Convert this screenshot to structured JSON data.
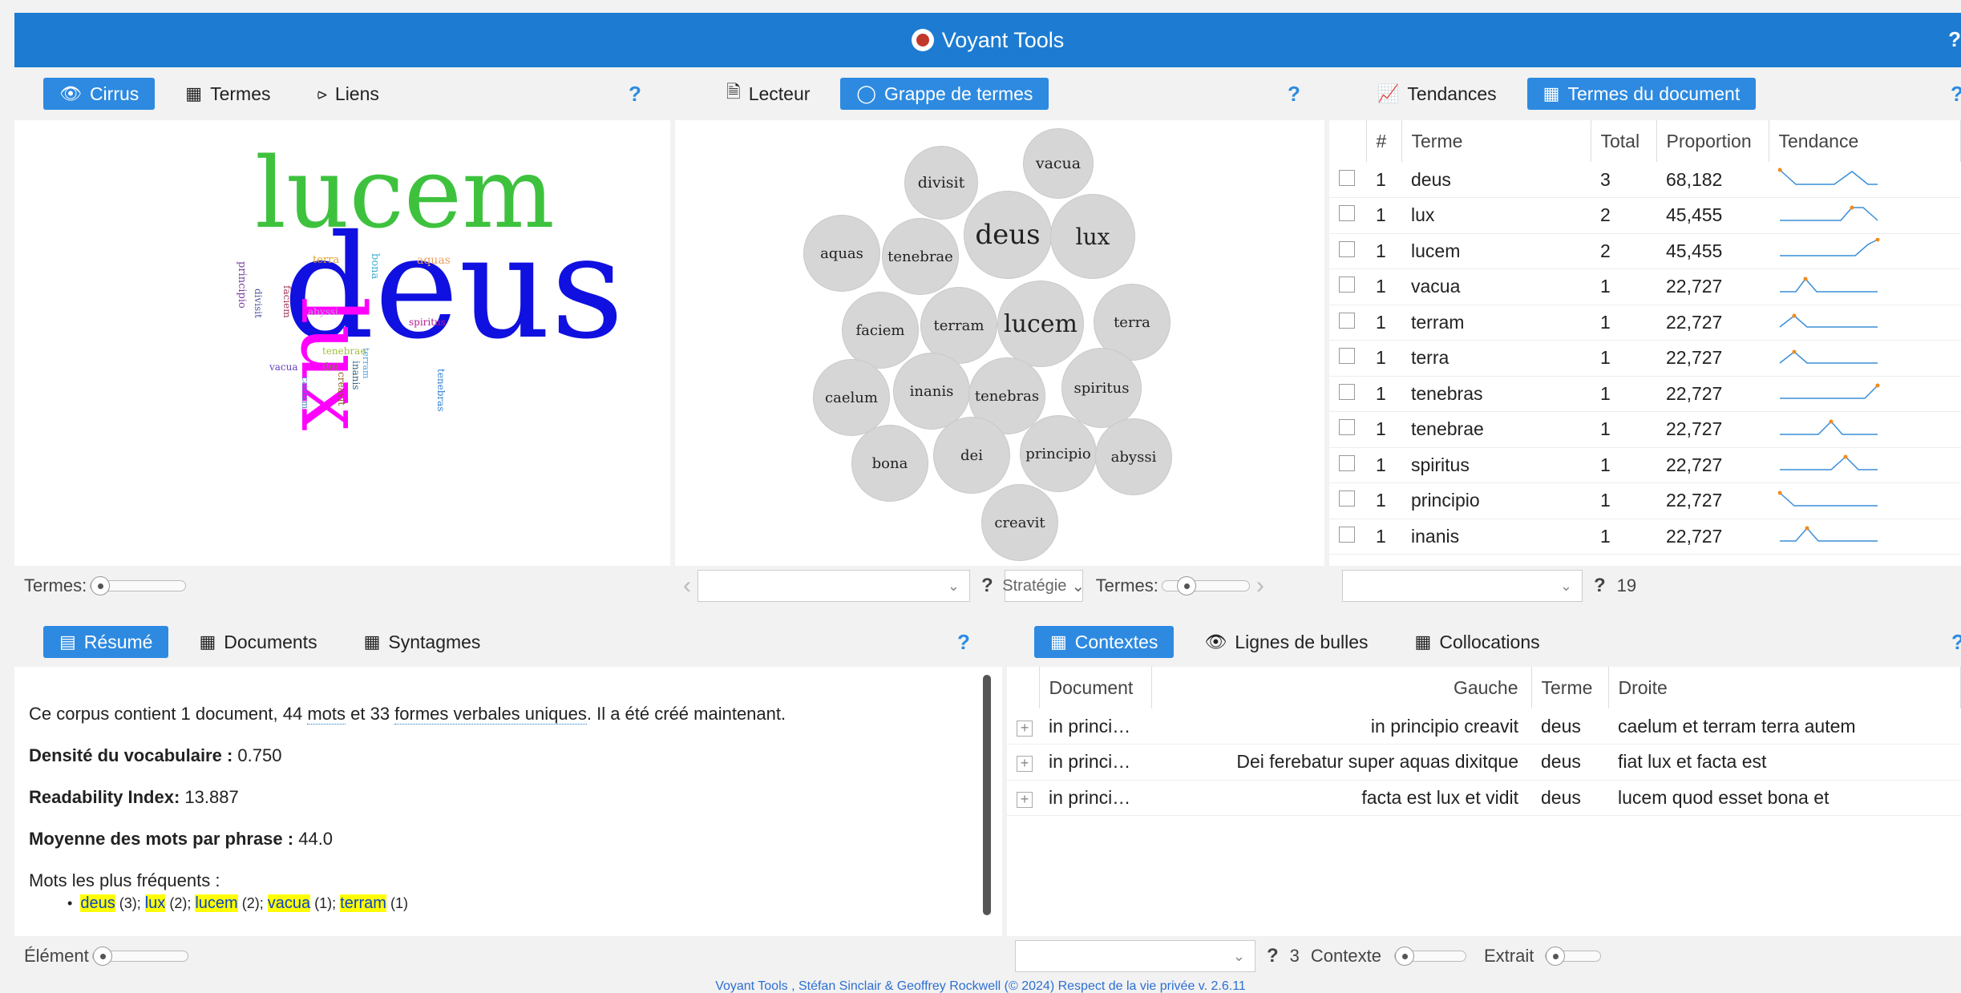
{
  "header": {
    "title": "Voyant Tools",
    "help": "?"
  },
  "cirrus_panel": {
    "tabs": [
      {
        "label": "Cirrus",
        "icon": "eye-icon"
      },
      {
        "label": "Termes",
        "icon": "table-icon"
      },
      {
        "label": "Liens",
        "icon": "share-icon"
      }
    ],
    "help": "?",
    "terms_label": "Termes:",
    "words": [
      {
        "text": "lucem",
        "color": "#3ec23e"
      },
      {
        "text": "deus",
        "color": "#1010e0"
      },
      {
        "text": "lux",
        "color": "#ff00ff"
      },
      {
        "text": "aquas",
        "color": "#e8a060"
      },
      {
        "text": "terra",
        "color": "#e0a030"
      },
      {
        "text": "bona",
        "color": "#40b0d0"
      },
      {
        "text": "principio",
        "color": "#7a40a0"
      },
      {
        "text": "faciem",
        "color": "#a03050"
      },
      {
        "text": "divisit",
        "color": "#5050a0"
      },
      {
        "text": "abyssi",
        "color": "#c0a0d0"
      },
      {
        "text": "spiritus",
        "color": "#b02090"
      },
      {
        "text": "tenebrae",
        "color": "#a0c040"
      },
      {
        "text": "terram",
        "color": "#50a0e0"
      },
      {
        "text": "vacua",
        "color": "#6040c0"
      },
      {
        "text": "dei",
        "color": "#808040"
      },
      {
        "text": "inanis",
        "color": "#306080"
      },
      {
        "text": "caelum",
        "color": "#5080c0"
      },
      {
        "text": "creavit",
        "color": "#8a5a20"
      },
      {
        "text": "tenebras",
        "color": "#3080d0"
      }
    ]
  },
  "grappe_panel": {
    "tabs": [
      {
        "label": "Lecteur",
        "icon": "document-icon"
      },
      {
        "label": "Grappe de termes",
        "icon": "circle-icon"
      }
    ],
    "help": "?",
    "bubbles": [
      "vacua",
      "divisit",
      "deus",
      "lux",
      "aquas",
      "tenebrae",
      "faciem",
      "terram",
      "lucem",
      "terra",
      "caelum",
      "inanis",
      "tenebras",
      "spiritus",
      "bona",
      "dei",
      "principio",
      "abyssi",
      "creavit"
    ],
    "strategy_label": "Stratégie",
    "terms_label": "Termes:"
  },
  "termes_panel": {
    "tabs": [
      {
        "label": "Tendances",
        "icon": "line-chart-icon"
      },
      {
        "label": "Termes du document",
        "icon": "table-icon"
      }
    ],
    "help": "?",
    "columns": [
      "#",
      "Terme",
      "Total",
      "Proportion",
      "Tendance"
    ],
    "rows": [
      {
        "num": "1",
        "term": "deus",
        "total": "3",
        "proportion": "68,182"
      },
      {
        "num": "1",
        "term": "lux",
        "total": "2",
        "proportion": "45,455"
      },
      {
        "num": "1",
        "term": "lucem",
        "total": "2",
        "proportion": "45,455"
      },
      {
        "num": "1",
        "term": "vacua",
        "total": "1",
        "proportion": "22,727"
      },
      {
        "num": "1",
        "term": "terram",
        "total": "1",
        "proportion": "22,727"
      },
      {
        "num": "1",
        "term": "terra",
        "total": "1",
        "proportion": "22,727"
      },
      {
        "num": "1",
        "term": "tenebras",
        "total": "1",
        "proportion": "22,727"
      },
      {
        "num": "1",
        "term": "tenebrae",
        "total": "1",
        "proportion": "22,727"
      },
      {
        "num": "1",
        "term": "spiritus",
        "total": "1",
        "proportion": "22,727"
      },
      {
        "num": "1",
        "term": "principio",
        "total": "1",
        "proportion": "22,727"
      },
      {
        "num": "1",
        "term": "inanis",
        "total": "1",
        "proportion": "22,727"
      }
    ],
    "count": "19"
  },
  "resume_panel": {
    "tabs": [
      {
        "label": "Résumé",
        "icon": "summary-icon"
      },
      {
        "label": "Documents",
        "icon": "table-icon"
      },
      {
        "label": "Syntagmes",
        "icon": "table-icon"
      }
    ],
    "help": "?",
    "intro_1": "Ce corpus contient 1 document, 44 ",
    "intro_mots": "mots",
    "intro_2": " et 33 ",
    "intro_formes": "formes verbales uniques",
    "intro_3": ". Il a été créé maintenant.",
    "density_label": "Densité du vocabulaire :",
    "density_value": "0.750",
    "readability_label": "Readability Index:",
    "readability_value": "13.887",
    "avg_label": "Moyenne des mots par phrase :",
    "avg_value": "44.0",
    "freq_label": "Mots les plus fréquents :",
    "freq": [
      {
        "term": "deus",
        "count": "(3)"
      },
      {
        "term": "lux",
        "count": "(2)"
      },
      {
        "term": "lucem",
        "count": "(2)"
      },
      {
        "term": "vacua",
        "count": "(1)"
      },
      {
        "term": "terram",
        "count": "(1)"
      }
    ],
    "element_label": "Élément"
  },
  "contexts_panel": {
    "tabs": [
      {
        "label": "Contextes",
        "icon": "table-icon"
      },
      {
        "label": "Lignes de bulles",
        "icon": "eye-icon"
      },
      {
        "label": "Collocations",
        "icon": "table-icon"
      }
    ],
    "help": "?",
    "columns": [
      "Document",
      "Gauche",
      "Terme",
      "Droite"
    ],
    "rows": [
      {
        "doc": "in princi…",
        "left": "in principio creavit",
        "term": "deus",
        "right": "caelum et terram terra autem"
      },
      {
        "doc": "in princi…",
        "left": "Dei ferebatur super aquas dixitque",
        "term": "deus",
        "right": "fiat lux et facta est"
      },
      {
        "doc": "in princi…",
        "left": "facta est lux et vidit",
        "term": "deus",
        "right": "lucem quod esset bona et"
      }
    ],
    "count": "3",
    "context_label": "Contexte",
    "extract_label": "Extrait"
  },
  "footer": {
    "text": "Voyant Tools , Stéfan Sinclair & Geoffrey Rockwell (© 2024) Respect de la vie privée v. 2.6.11"
  }
}
